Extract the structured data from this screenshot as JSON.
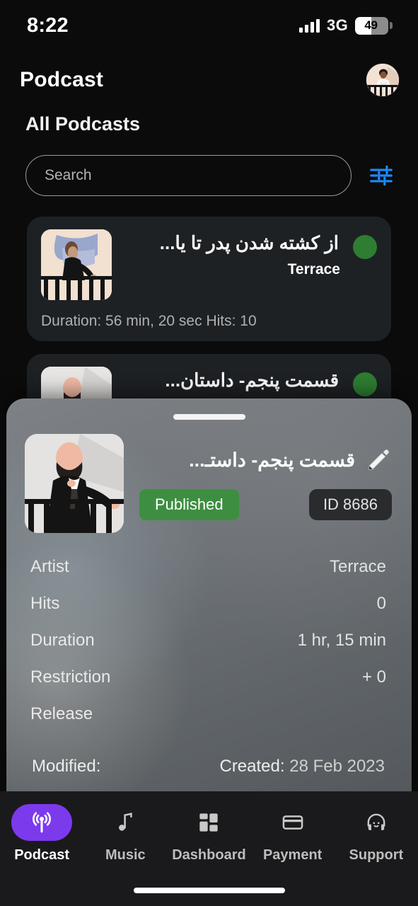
{
  "status_bar": {
    "time": "8:22",
    "network": "3G",
    "battery_level": "49",
    "battery_percent": 49
  },
  "header": {
    "app_title": "Podcast",
    "avatar_label": "User avatar"
  },
  "section": {
    "title": "All Podcasts"
  },
  "search": {
    "placeholder": "Search",
    "value": "",
    "filter_icon": "sliders-icon"
  },
  "podcasts": [
    {
      "title": "از کشته شدن پدر تا یا...",
      "artist": "Terrace",
      "meta": "Duration: 56 min, 20 sec Hits: 10",
      "status_color": "#2e7d32"
    },
    {
      "title": "قسمت پنجم- داستان...",
      "artist": "",
      "meta": "",
      "status_color": "#2e7d32"
    }
  ],
  "sheet": {
    "title": "قسمت پنجم- داستـ...",
    "edit_icon": "pencil-icon",
    "status_badge": "Published",
    "id_badge": "ID 8686",
    "details": [
      {
        "label": "Artist",
        "value": "Terrace"
      },
      {
        "label": "Hits",
        "value": "0"
      },
      {
        "label": "Duration",
        "value": "1 hr, 15 min"
      },
      {
        "label": "Restriction",
        "value": "+ 0"
      },
      {
        "label": "Release",
        "value": ""
      }
    ],
    "footer": {
      "modified_label": "Modified:",
      "created_label": "Created:",
      "created_value": "28 Feb 2023"
    }
  },
  "tabbar": {
    "items": [
      {
        "label": "Podcast",
        "icon": "broadcast-icon",
        "active": true
      },
      {
        "label": "Music",
        "icon": "music-note-icon",
        "active": false
      },
      {
        "label": "Dashboard",
        "icon": "grid-icon",
        "active": false
      },
      {
        "label": "Payment",
        "icon": "credit-card-icon",
        "active": false
      },
      {
        "label": "Support",
        "icon": "headset-icon",
        "active": false
      }
    ]
  },
  "colors": {
    "accent_purple": "#7c3aed",
    "filter_blue": "#1a8cff",
    "status_green": "#2e7d32",
    "published_green": "#3e8e41",
    "card_bg": "#1e2124"
  }
}
